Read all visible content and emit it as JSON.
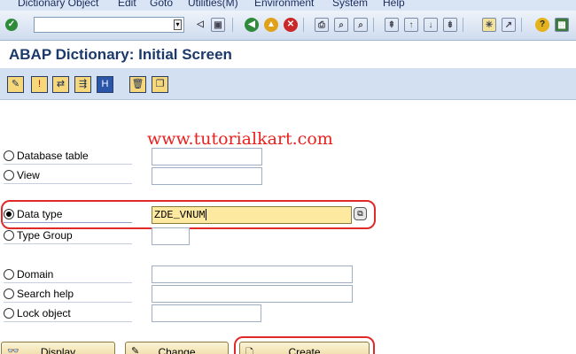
{
  "menu": [
    "Dictionary Object",
    "Edit",
    "Goto",
    "Utilities(M)",
    "Environment",
    "System",
    "Help"
  ],
  "title": "ABAP Dictionary: Initial Screen",
  "watermark": "www.tutorialkart.com",
  "options": [
    {
      "label": "Database table",
      "selected": false,
      "value": ""
    },
    {
      "label": "View",
      "selected": false,
      "value": ""
    },
    {
      "label": "Data type",
      "selected": true,
      "value": "ZDE_VNUM"
    },
    {
      "label": "Type Group",
      "selected": false,
      "value": ""
    },
    {
      "label": "Domain",
      "selected": false,
      "value": ""
    },
    {
      "label": "Search help",
      "selected": false,
      "value": ""
    },
    {
      "label": "Lock object",
      "selected": false,
      "value": ""
    }
  ],
  "buttons": {
    "display": "Display",
    "change": "Change",
    "create": "Create"
  },
  "colors": {
    "highlight": "#e02a2a",
    "watermark": "#e8221f",
    "title": "#1b3a6b"
  }
}
